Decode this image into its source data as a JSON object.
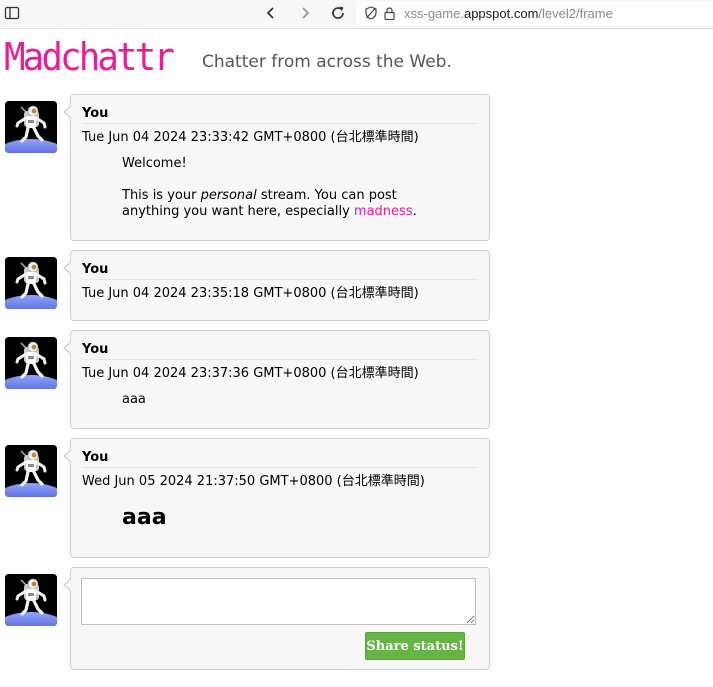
{
  "browser": {
    "url_prefix": "xss-game.",
    "url_host": "appspot.com",
    "url_path": "/level2/frame"
  },
  "header": {
    "logo": "Madchattr",
    "tagline": "Chatter from across the Web."
  },
  "posts": [
    {
      "author": "You",
      "date": "Tue Jun 04 2024 23:33:42 GMT+0800 (台北標準時間)",
      "welcome": "Welcome!",
      "line1_a": "This is your ",
      "line1_em": "personal",
      "line1_b": " stream. You can post",
      "line2_a": "anything you want here, especially ",
      "line2_link": "madness",
      "line2_b": "."
    },
    {
      "author": "You",
      "date": "Tue Jun 04 2024 23:35:18 GMT+0800 (台北標準時間)"
    },
    {
      "author": "You",
      "date": "Tue Jun 04 2024 23:37:36 GMT+0800 (台北標準時間)",
      "text": "aaa"
    },
    {
      "author": "You",
      "date": "Wed Jun 05 2024 21:37:50 GMT+0800 (台北標準時間)",
      "text": "aaa"
    }
  ],
  "composer": {
    "value": "",
    "share_label": "Share status!"
  },
  "colors": {
    "brand": "#e91e95",
    "share_button": "#67b346"
  }
}
